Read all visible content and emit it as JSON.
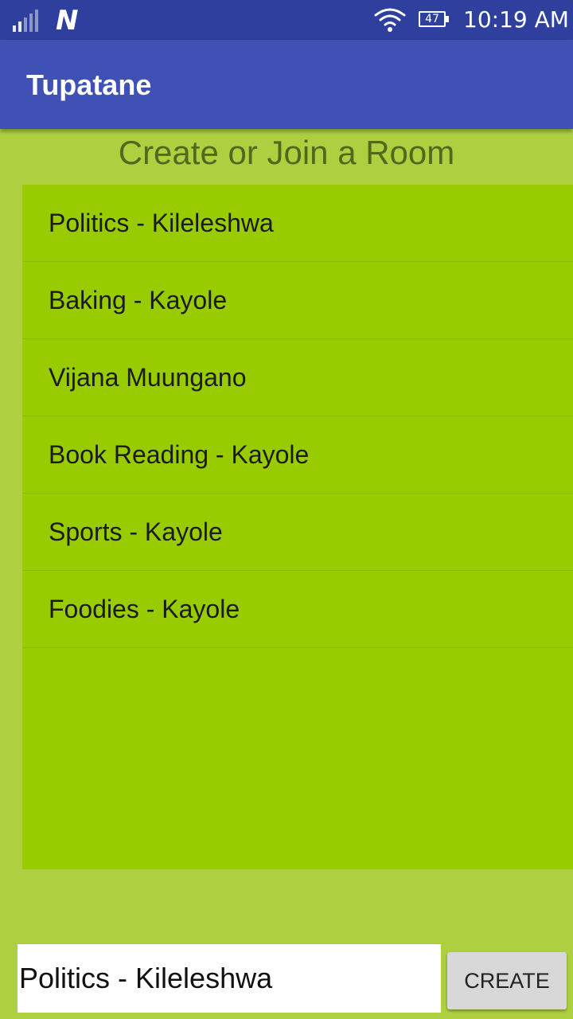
{
  "status_bar": {
    "notification_glyph": "N",
    "battery_level": "47",
    "time": "10:19 AM",
    "icons": [
      "signal-icon",
      "n-notification-icon",
      "wifi-icon",
      "battery-icon"
    ]
  },
  "app_bar": {
    "title": "Tupatane"
  },
  "heading": "Create or Join a Room",
  "rooms": [
    {
      "label": "Politics - Kileleshwa"
    },
    {
      "label": "Baking - Kayole"
    },
    {
      "label": "Vijana Muungano"
    },
    {
      "label": "Book Reading - Kayole"
    },
    {
      "label": "Sports - Kayole"
    },
    {
      "label": "Foodies - Kayole"
    }
  ],
  "room_input": {
    "value": "Politics - Kileleshwa"
  },
  "create_button": {
    "label": "CREATE"
  },
  "colors": {
    "status_bar": "#2f3f9e",
    "app_bar": "#3f51b5",
    "background": "#aed040",
    "list_background": "#99cc00",
    "heading_text": "#506a1d",
    "button_background": "#d8d8d8"
  }
}
